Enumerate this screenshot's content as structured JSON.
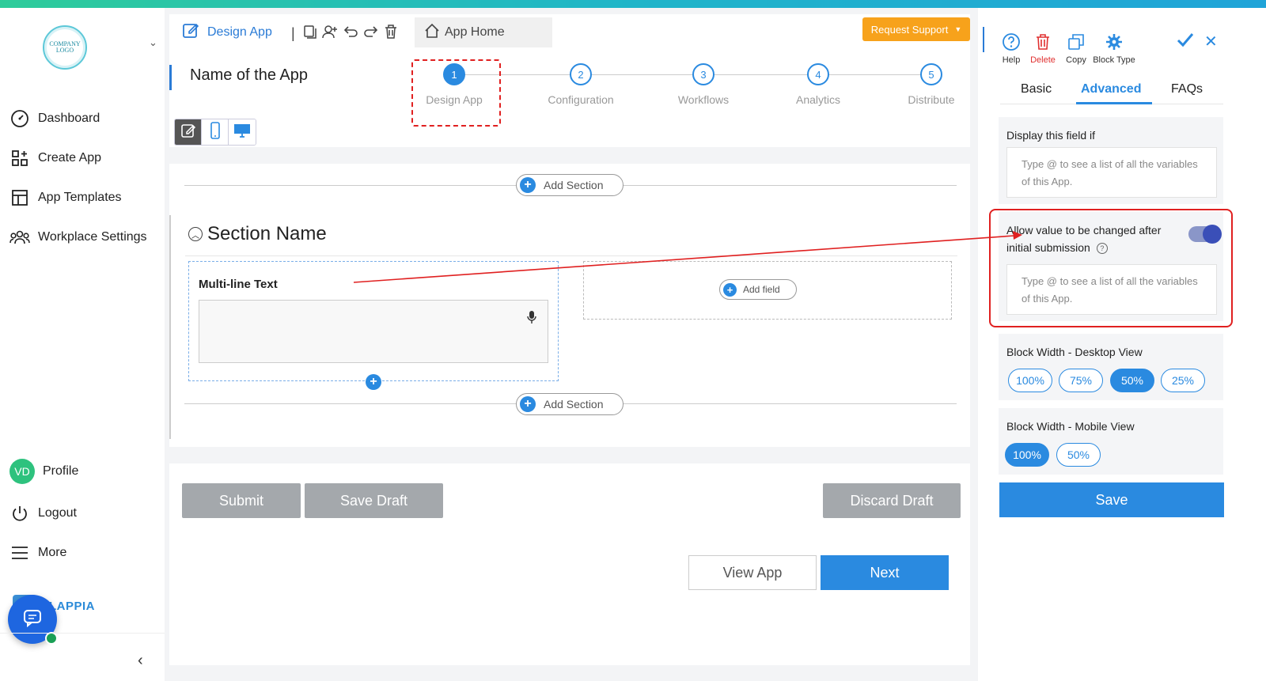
{
  "sidebar": {
    "logo_text": "COMPANY LOGO",
    "items": [
      {
        "label": "Dashboard",
        "icon": "dashboard-icon"
      },
      {
        "label": "Create App",
        "icon": "create-app-icon"
      },
      {
        "label": "App Templates",
        "icon": "templates-icon"
      },
      {
        "label": "Workplace Settings",
        "icon": "people-icon"
      }
    ],
    "profile_initials": "VD",
    "profile_label": "Profile",
    "logout_label": "Logout",
    "more_label": "More",
    "brand": "LAPPIA"
  },
  "header": {
    "design_tab": "Design App",
    "app_home": "App Home",
    "request_support": "Request Support",
    "app_name": "Name of the App"
  },
  "steps": [
    {
      "num": "1",
      "label": "Design App",
      "active": true
    },
    {
      "num": "2",
      "label": "Configuration",
      "active": false
    },
    {
      "num": "3",
      "label": "Workflows",
      "active": false
    },
    {
      "num": "4",
      "label": "Analytics",
      "active": false
    },
    {
      "num": "5",
      "label": "Distribute",
      "active": false
    }
  ],
  "form": {
    "add_section": "Add Section",
    "section_name": "Section Name",
    "field_label": "Multi-line Text",
    "add_field": "Add field"
  },
  "actions": {
    "submit": "Submit",
    "save_draft": "Save Draft",
    "discard_draft": "Discard Draft",
    "view_app": "View App",
    "next": "Next"
  },
  "panel": {
    "tools": {
      "help": "Help",
      "delete": "Delete",
      "copy": "Copy",
      "block_type": "Block Type"
    },
    "tabs": {
      "basic": "Basic",
      "advanced": "Advanced",
      "faqs": "FAQs"
    },
    "display_if_title": "Display this field if",
    "variables_hint": "Type @ to see a list of all the variables of this App.",
    "allow_change_title": "Allow value to be changed after initial submission",
    "allow_change_enabled": true,
    "desktop_width_title": "Block Width - Desktop View",
    "desktop_options": [
      "100%",
      "75%",
      "50%",
      "25%"
    ],
    "desktop_selected": "50%",
    "mobile_width_title": "Block Width - Mobile View",
    "mobile_options": [
      "100%",
      "50%"
    ],
    "mobile_selected": "100%",
    "save": "Save"
  },
  "colors": {
    "accent": "#2a8ae0",
    "support": "#f7a21b",
    "highlight": "#e02020",
    "disabled": "#a4a8ac"
  }
}
